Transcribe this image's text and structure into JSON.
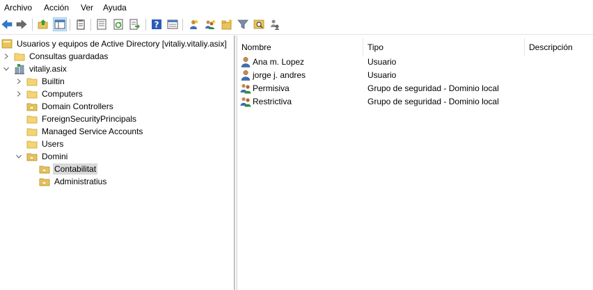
{
  "menu": [
    "Archivo",
    "Acción",
    "Ver",
    "Ayuda"
  ],
  "toolbar": {
    "buttons": [
      "back-icon",
      "forward-icon",
      "up-folder-icon",
      "console-tree-icon",
      "clipboard-icon",
      "properties-icon",
      "refresh-icon",
      "export-list-icon",
      "help-icon",
      "view-icon",
      "new-user-icon",
      "new-group-icon",
      "new-ou-icon",
      "filter-icon",
      "find-icon",
      "delegate-icon"
    ]
  },
  "tree": {
    "root": "Usuarios y equipos de Active Directory [vitaliy.vitaliy.asix]",
    "saved_queries": "Consultas guardadas",
    "domain": "vitaliy.asix",
    "children": [
      "Builtin",
      "Computers",
      "Domain Controllers",
      "ForeignSecurityPrincipals",
      "Managed Service Accounts",
      "Users",
      "Domini"
    ],
    "domini_children": [
      "Contabilitat",
      "Administratius"
    ],
    "selected": "Contabilitat"
  },
  "list": {
    "columns": [
      "Nombre",
      "Tipo",
      "Descripción"
    ],
    "rows": [
      {
        "name": "Ana m. Lopez",
        "type": "Usuario",
        "icon": "user-icon"
      },
      {
        "name": "jorge j. andres",
        "type": "Usuario",
        "icon": "user-icon"
      },
      {
        "name": "Permisiva",
        "type": "Grupo de seguridad - Dominio local",
        "icon": "group-icon"
      },
      {
        "name": "Restrictiva",
        "type": "Grupo de seguridad - Dominio local",
        "icon": "group-icon"
      }
    ]
  },
  "colors": {
    "folder": "#e8c45a",
    "selection": "#d9d9d9",
    "accent": "#1e73be"
  }
}
